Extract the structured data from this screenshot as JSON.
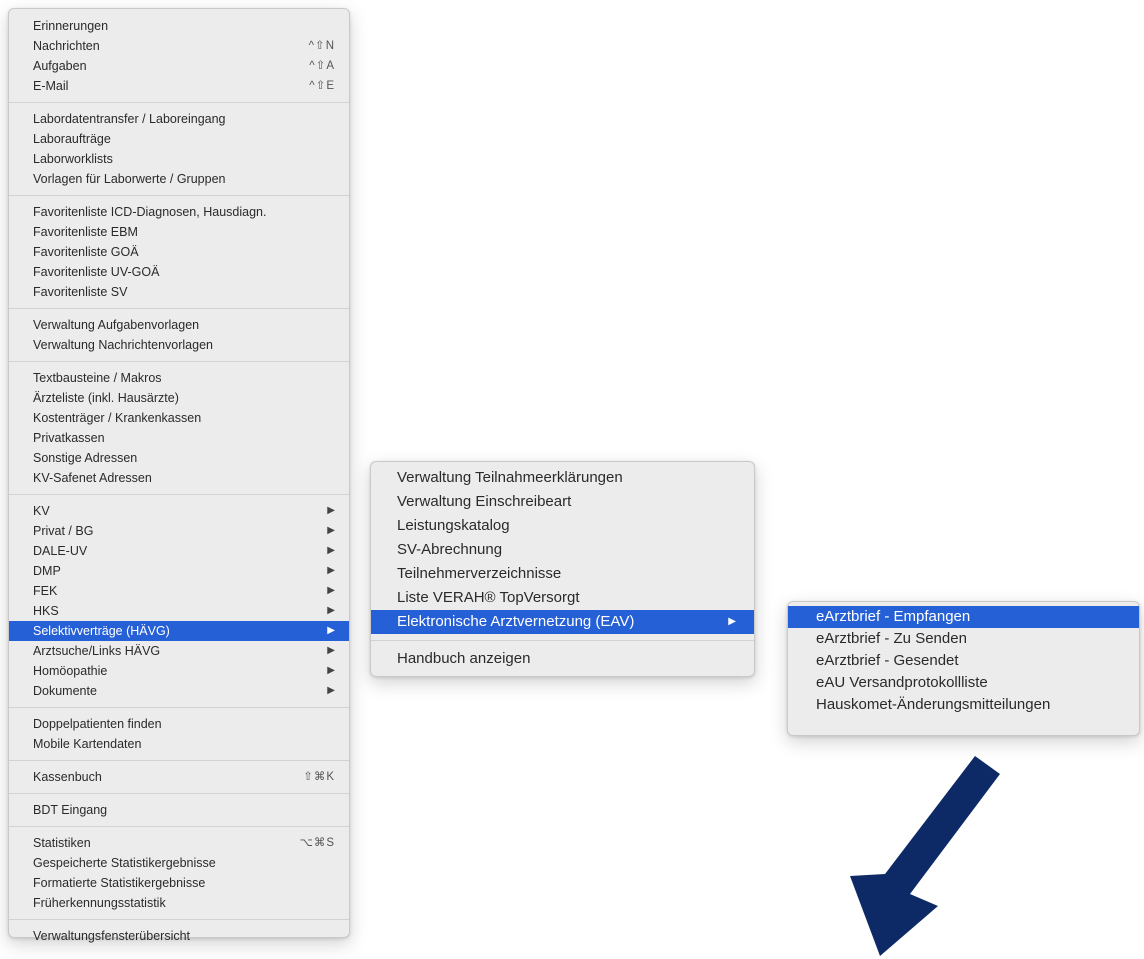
{
  "main_menu": {
    "groups": [
      [
        {
          "label": "Erinnerungen"
        },
        {
          "label": "Nachrichten",
          "shortcut": "^⇧N"
        },
        {
          "label": "Aufgaben",
          "shortcut": "^⇧A"
        },
        {
          "label": "E-Mail",
          "shortcut": "^⇧E"
        }
      ],
      [
        {
          "label": "Labordatentransfer / Laboreingang"
        },
        {
          "label": "Laboraufträge"
        },
        {
          "label": "Laborworklists"
        },
        {
          "label": "Vorlagen für Laborwerte / Gruppen"
        }
      ],
      [
        {
          "label": "Favoritenliste ICD-Diagnosen, Hausdiagn."
        },
        {
          "label": "Favoritenliste EBM"
        },
        {
          "label": "Favoritenliste GOÄ"
        },
        {
          "label": "Favoritenliste UV-GOÄ"
        },
        {
          "label": "Favoritenliste SV"
        }
      ],
      [
        {
          "label": "Verwaltung Aufgabenvorlagen"
        },
        {
          "label": "Verwaltung Nachrichtenvorlagen"
        }
      ],
      [
        {
          "label": "Textbausteine / Makros"
        },
        {
          "label": "Ärzteliste (inkl. Hausärzte)"
        },
        {
          "label": "Kostenträger / Krankenkassen"
        },
        {
          "label": "Privatkassen"
        },
        {
          "label": "Sonstige Adressen"
        },
        {
          "label": "KV-Safenet Adressen"
        }
      ],
      [
        {
          "label": "KV",
          "submenu": true
        },
        {
          "label": "Privat / BG",
          "submenu": true
        },
        {
          "label": "DALE-UV",
          "submenu": true
        },
        {
          "label": "DMP",
          "submenu": true
        },
        {
          "label": "FEK",
          "submenu": true
        },
        {
          "label": "HKS",
          "submenu": true
        },
        {
          "label": "Selektivverträge (HÄVG)",
          "submenu": true,
          "selected": true
        },
        {
          "label": "Arztsuche/Links HÄVG",
          "submenu": true
        },
        {
          "label": "Homöopathie",
          "submenu": true
        },
        {
          "label": "Dokumente",
          "submenu": true
        }
      ],
      [
        {
          "label": "Doppelpatienten finden"
        },
        {
          "label": "Mobile Kartendaten"
        }
      ],
      [
        {
          "label": "Kassenbuch",
          "shortcut": "⇧⌘K"
        }
      ],
      [
        {
          "label": "BDT Eingang"
        }
      ],
      [
        {
          "label": "Statistiken",
          "shortcut": "⌥⌘S"
        },
        {
          "label": "Gespeicherte Statistikergebnisse"
        },
        {
          "label": "Formatierte Statistikergebnisse"
        },
        {
          "label": "Früherkennungsstatistik"
        }
      ],
      [
        {
          "label": "Verwaltungsfensterübersicht"
        }
      ]
    ]
  },
  "submenu_selektiv": {
    "groups": [
      [
        {
          "label": "Verwaltung Teilnahmeerklärungen"
        },
        {
          "label": "Verwaltung Einschreibeart"
        },
        {
          "label": "Leistungskatalog"
        },
        {
          "label": "SV-Abrechnung"
        },
        {
          "label": "Teilnehmerverzeichnisse"
        },
        {
          "label": "Liste VERAH® TopVersorgt"
        },
        {
          "label": "Elektronische Arztvernetzung (EAV)",
          "submenu": true,
          "selected": true
        }
      ],
      [
        {
          "label": "Handbuch anzeigen"
        }
      ]
    ]
  },
  "submenu_eav": {
    "groups": [
      [
        {
          "label": "eArztbrief - Empfangen",
          "selected": true
        },
        {
          "label": "eArztbrief - Zu Senden"
        },
        {
          "label": "eArztbrief - Gesendet"
        },
        {
          "label": "eAU Versandprotokollliste"
        },
        {
          "label": "Hauskomet-Änderungsmitteilungen"
        }
      ]
    ]
  },
  "submenu_arrow_glyph": "▶",
  "annotation_arrow": {
    "color": "#0d2a66",
    "direction": "down-left",
    "icon": "arrow-down-left-icon"
  },
  "colors": {
    "selection": "#2660d6",
    "menu_bg": "#ececec"
  }
}
